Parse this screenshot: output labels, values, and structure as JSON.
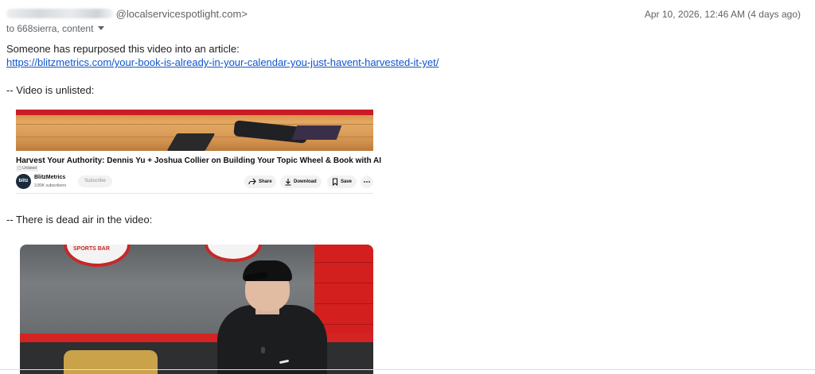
{
  "header": {
    "sender_email_suffix": "@localservicespotlight.com>",
    "date": "Apr 10, 2026, 12:46 AM (4 days ago)",
    "to": "to 668sierra, content"
  },
  "body": {
    "intro": "Someone has repurposed this video into an article:",
    "article_link": "https://blitzmetrics.com/your-book-is-already-in-your-calendar-you-just-havent-harvested-it-yet/",
    "unlisted_note": "-- Video is unlisted:",
    "dead_air_note": "-- There is dead air in the video:"
  },
  "youtube_card": {
    "title": "Harvest Your Authority: Dennis Yu + Joshua Collier on Building Your Topic Wheel & Book with AI",
    "unlisted_badge": "Unlisted",
    "channel_avatar_text": "blitz",
    "channel_name": "BlitzMetrics",
    "subscribers": "3.89K subscribers",
    "subscribe_label": "Subscribe",
    "share_label": "Share",
    "download_label": "Download",
    "save_label": "Save",
    "more_icon": "more-horizontal-icon"
  },
  "video_frame": {
    "logo_text": "SPORTS BAR"
  }
}
